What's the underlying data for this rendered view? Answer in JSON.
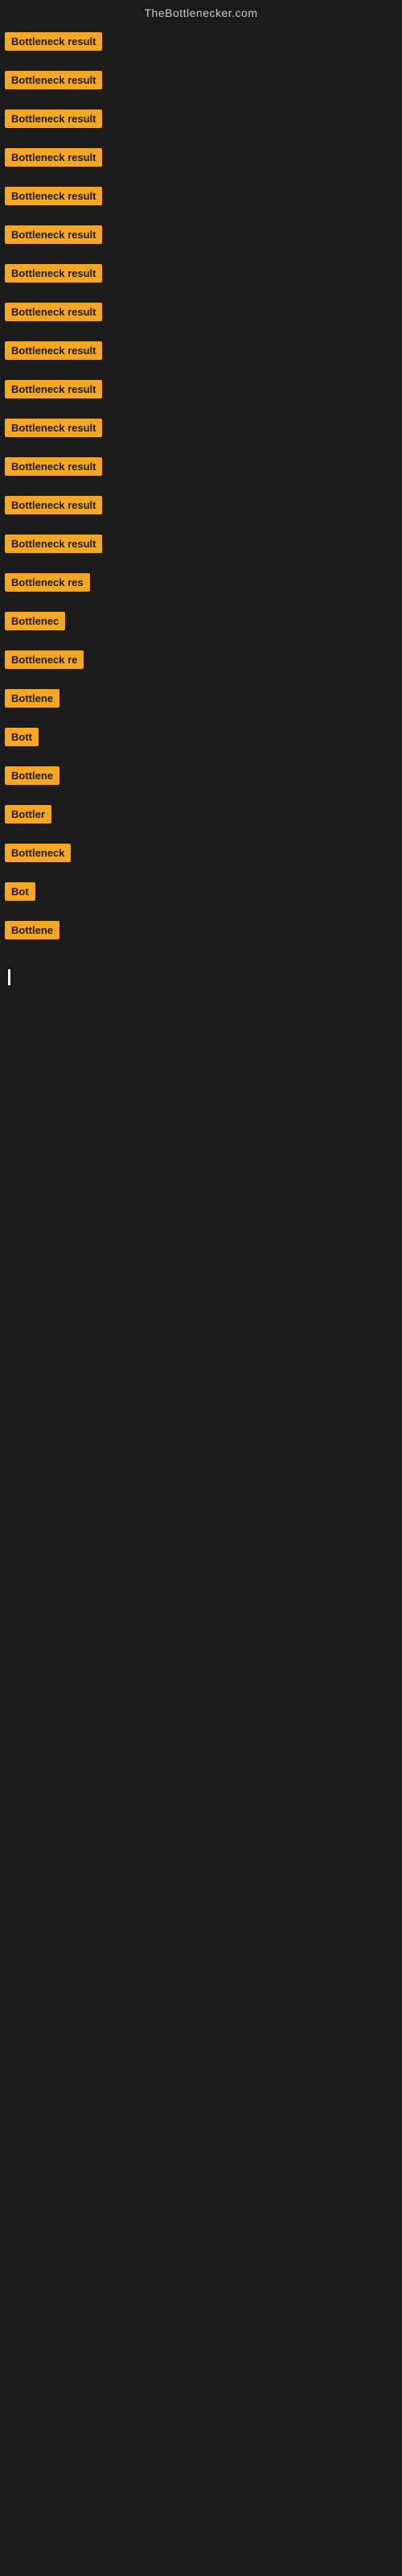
{
  "site": {
    "title": "TheBottlenecker.com"
  },
  "cards": [
    {
      "id": 1,
      "label": "Bottleneck result",
      "width": "full"
    },
    {
      "id": 2,
      "label": "Bottleneck result",
      "width": "full"
    },
    {
      "id": 3,
      "label": "Bottleneck result",
      "width": "full"
    },
    {
      "id": 4,
      "label": "Bottleneck result",
      "width": "full"
    },
    {
      "id": 5,
      "label": "Bottleneck result",
      "width": "full"
    },
    {
      "id": 6,
      "label": "Bottleneck result",
      "width": "full"
    },
    {
      "id": 7,
      "label": "Bottleneck result",
      "width": "full"
    },
    {
      "id": 8,
      "label": "Bottleneck result",
      "width": "full"
    },
    {
      "id": 9,
      "label": "Bottleneck result",
      "width": "full"
    },
    {
      "id": 10,
      "label": "Bottleneck result",
      "width": "full"
    },
    {
      "id": 11,
      "label": "Bottleneck result",
      "width": "full"
    },
    {
      "id": 12,
      "label": "Bottleneck result",
      "width": "full"
    },
    {
      "id": 13,
      "label": "Bottleneck result",
      "width": "full"
    },
    {
      "id": 14,
      "label": "Bottleneck result",
      "width": "full"
    },
    {
      "id": 15,
      "label": "Bottleneck res",
      "width": "partial"
    },
    {
      "id": 16,
      "label": "Bottlenec",
      "width": "short"
    },
    {
      "id": 17,
      "label": "Bottleneck re",
      "width": "partial"
    },
    {
      "id": 18,
      "label": "Bottlene",
      "width": "short"
    },
    {
      "id": 19,
      "label": "Bott",
      "width": "tiny"
    },
    {
      "id": 20,
      "label": "Bottlene",
      "width": "short"
    },
    {
      "id": 21,
      "label": "Bottler",
      "width": "short"
    },
    {
      "id": 22,
      "label": "Bottleneck",
      "width": "medium"
    },
    {
      "id": 23,
      "label": "Bot",
      "width": "tiny"
    },
    {
      "id": 24,
      "label": "Bottlene",
      "width": "short"
    }
  ],
  "colors": {
    "card_bg": "#f5a623",
    "card_text": "#1a1a1a",
    "body_bg": "#1a1a1a",
    "site_title": "#cccccc"
  }
}
